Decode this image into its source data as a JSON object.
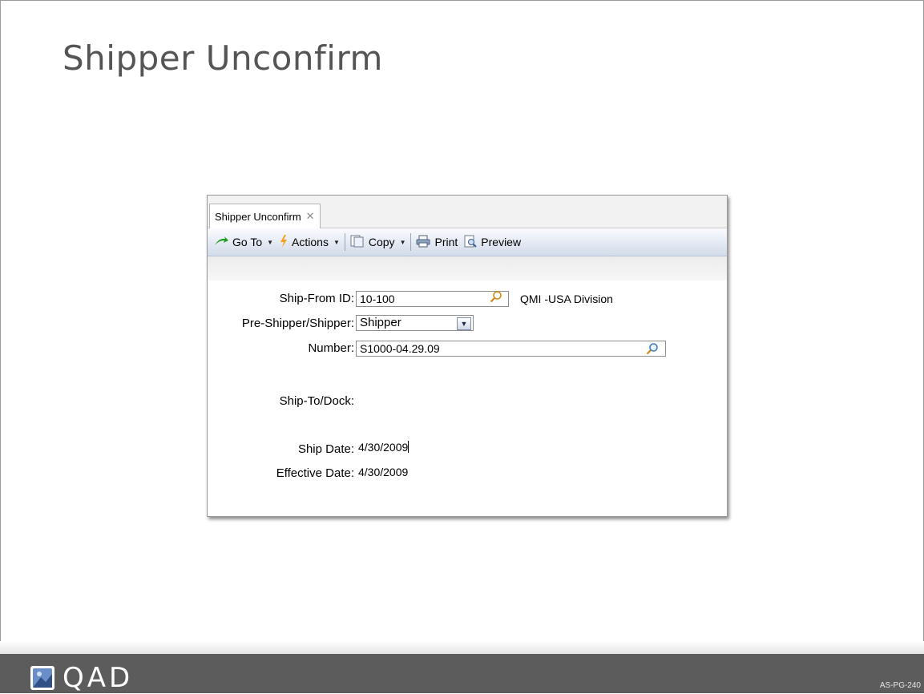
{
  "slide": {
    "title": "Shipper Unconfirm",
    "page_code": "AS-PG-240"
  },
  "brand": {
    "name": "QAD",
    "footer_color": "#5c5c5c"
  },
  "window": {
    "tab_label": "Shipper Unconfirm",
    "toolbar": {
      "goto_label": "Go To",
      "actions_label": "Actions",
      "copy_label": "Copy",
      "print_label": "Print",
      "preview_label": "Preview"
    },
    "form": {
      "ship_from_label": "Ship-From ID:",
      "ship_from_value": "10-100",
      "ship_from_desc": "QMI -USA Division",
      "pre_shipper_label": "Pre-Shipper/Shipper:",
      "pre_shipper_value": "Shipper",
      "number_label": "Number:",
      "number_value": "S1000-04.29.09",
      "ship_to_label": "Ship-To/Dock:",
      "ship_date_label": "Ship Date:",
      "ship_date_value": "4/30/2009",
      "effective_date_label": "Effective Date:",
      "effective_date_value": "4/30/2009"
    }
  }
}
